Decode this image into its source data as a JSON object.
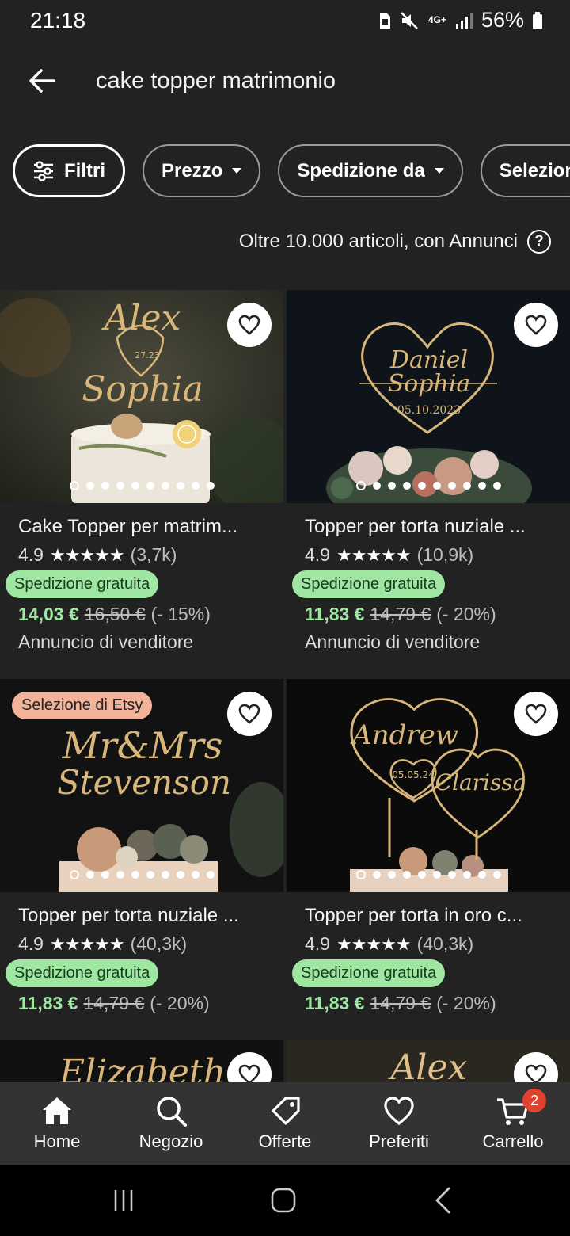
{
  "status": {
    "time": "21:18",
    "network": "4G+",
    "battery": "56%"
  },
  "search": {
    "query": "cake topper matrimonio"
  },
  "chips": [
    {
      "label": "Filtri"
    },
    {
      "label": "Prezzo"
    },
    {
      "label": "Spedizione da"
    },
    {
      "label": "Selezion"
    }
  ],
  "results": {
    "count_text": "Oltre 10.000 articoli, con Annunci"
  },
  "products": [
    {
      "title": "Cake Topper per matrim...",
      "rating": "4.9",
      "reviews": "(3,7k)",
      "shipping": "Spedizione gratuita",
      "price": "14,03 €",
      "old_price": "16,50 €",
      "discount": "(- 15%)",
      "ad_label": "Annuncio di venditore",
      "image_text": [
        "Alex",
        "Sophia",
        "27.23"
      ]
    },
    {
      "title": "Topper per torta nuziale ...",
      "rating": "4.9",
      "reviews": "(10,9k)",
      "shipping": "Spedizione gratuita",
      "price": "11,83 €",
      "old_price": "14,79 €",
      "discount": "(- 20%)",
      "ad_label": "Annuncio di venditore",
      "image_text": [
        "Daniel",
        "Sophia",
        "05.10.2023"
      ]
    },
    {
      "badge": "Selezione di Etsy",
      "title": "Topper per torta nuziale ...",
      "rating": "4.9",
      "reviews": "(40,3k)",
      "shipping": "Spedizione gratuita",
      "price": "11,83 €",
      "old_price": "14,79 €",
      "discount": "(- 20%)",
      "image_text": [
        "Mr&Mrs",
        "Stevenson"
      ]
    },
    {
      "title": "Topper per torta in oro c...",
      "rating": "4.9",
      "reviews": "(40,3k)",
      "shipping": "Spedizione gratuita",
      "price": "11,83 €",
      "old_price": "14,79 €",
      "discount": "(- 20%)",
      "image_text": [
        "Andrew",
        "05.05.24",
        "Clarissa"
      ]
    },
    {
      "image_text": [
        "Elizabeth"
      ]
    },
    {
      "image_text": [
        "Alex"
      ]
    }
  ],
  "nav": [
    {
      "label": "Home",
      "icon": "home-icon"
    },
    {
      "label": "Negozio",
      "icon": "search-icon"
    },
    {
      "label": "Offerte",
      "icon": "tag-icon"
    },
    {
      "label": "Preferiti",
      "icon": "heart-icon"
    },
    {
      "label": "Carrello",
      "icon": "cart-icon",
      "badge": "2"
    }
  ],
  "colors": {
    "background": "#222222",
    "free_shipping": "#9ee6a1",
    "etsy_pick": "#f3b29a",
    "cart_badge": "#e1422d"
  }
}
